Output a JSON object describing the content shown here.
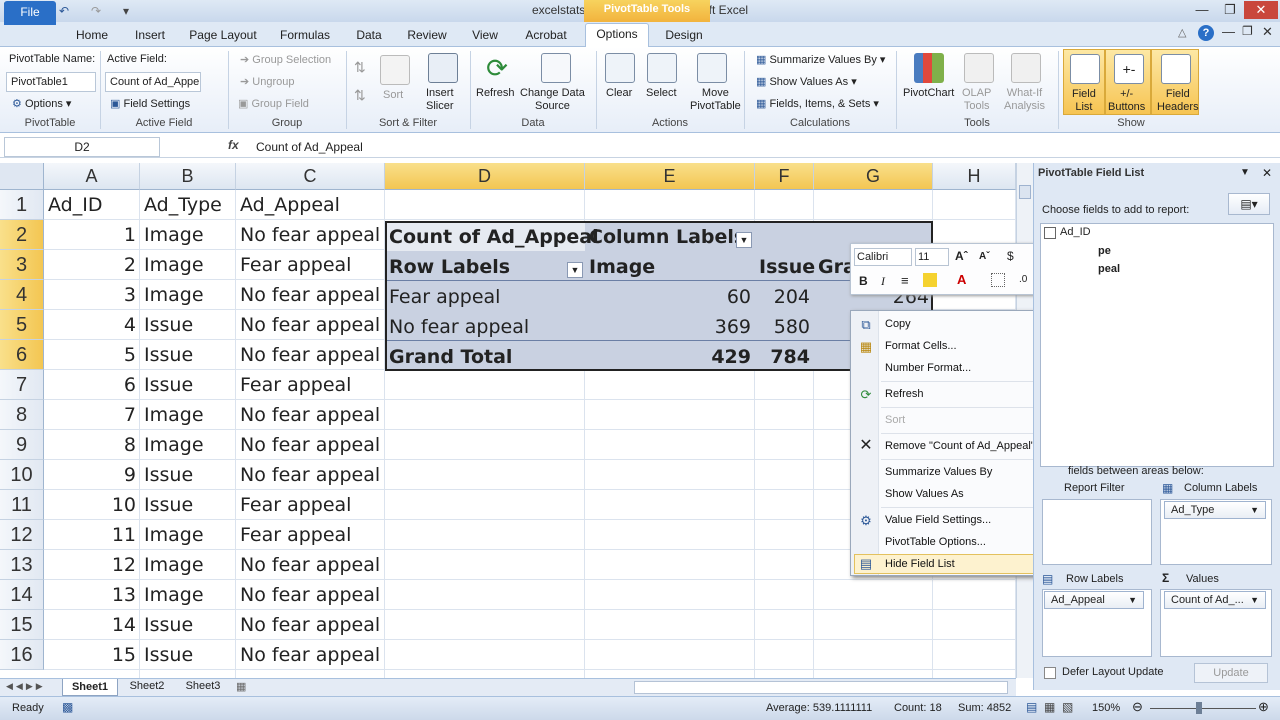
{
  "title": "excelstats_2sampchisq  -  Microsoft Excel",
  "context_tab": "PivotTable Tools",
  "tabs": [
    "File",
    "Home",
    "Insert",
    "Page Layout",
    "Formulas",
    "Data",
    "Review",
    "View",
    "Acrobat",
    "Options",
    "Design"
  ],
  "ribbon": {
    "pt_name_label": "PivotTable Name:",
    "pt_name": "PivotTable1",
    "options": "Options",
    "pivottable_group": "PivotTable",
    "active_field_label": "Active Field:",
    "active_field": "Count of Ad_Appe",
    "field_settings": "Field Settings",
    "active_field_group": "Active Field",
    "group_selection": "Group Selection",
    "ungroup": "Ungroup",
    "group_field": "Group Field",
    "group_group": "Group",
    "sort": "Sort",
    "sort_filter_group": "Sort & Filter",
    "insert_slicer": "Insert\nSlicer",
    "refresh": "Refresh",
    "change_data_source": "Change Data\nSource",
    "data_group": "Data",
    "clear": "Clear",
    "select": "Select",
    "move_pivottable": "Move\nPivotTable",
    "actions_group": "Actions",
    "summarize_values_by": "Summarize Values By",
    "show_values_as": "Show Values As",
    "fields_items_sets": "Fields, Items, & Sets",
    "calculations_group": "Calculations",
    "pivotchart": "PivotChart",
    "olap_tools": "OLAP\nTools",
    "what_if": "What-If\nAnalysis",
    "tools_group": "Tools",
    "field_list": "Field\nList",
    "plus_minus_buttons": "+/-\nButtons",
    "field_headers": "Field\nHeaders",
    "show_group": "Show"
  },
  "name_box": "D2",
  "formula": "Count of Ad_Appeal",
  "columns": [
    "A",
    "B",
    "C",
    "D",
    "E",
    "F",
    "G",
    "H"
  ],
  "rows": [
    "1",
    "2",
    "3",
    "4",
    "5",
    "6",
    "7",
    "8",
    "9",
    "10",
    "11",
    "12",
    "13",
    "14",
    "15",
    "16"
  ],
  "data": {
    "headers": [
      "Ad_ID",
      "Ad_Type",
      "Ad_Appeal"
    ],
    "id": [
      "1",
      "2",
      "3",
      "4",
      "5",
      "6",
      "7",
      "8",
      "9",
      "10",
      "11",
      "12",
      "13",
      "14",
      "15"
    ],
    "type": [
      "Image",
      "Image",
      "Image",
      "Issue",
      "Issue",
      "Issue",
      "Image",
      "Image",
      "Issue",
      "Issue",
      "Image",
      "Image",
      "Image",
      "Issue",
      "Issue"
    ],
    "appeal": [
      "No fear appeal",
      "Fear appeal",
      "No fear appeal",
      "No fear appeal",
      "No fear appeal",
      "Fear appeal",
      "No fear appeal",
      "No fear appeal",
      "No fear appeal",
      "Fear appeal",
      "Fear appeal",
      "No fear appeal",
      "No fear appeal",
      "No fear appeal",
      "No fear appeal"
    ]
  },
  "pivot": {
    "count_label": "Count of Ad_Appeal",
    "column_labels": "Column Labels",
    "row_labels": "Row Labels",
    "image": "Image",
    "issue": "Issue",
    "grand_col": "Gra",
    "r1_label": "Fear appeal",
    "r1_image": "60",
    "r1_issue": "204",
    "r1_total": "264",
    "r2_label": "No fear appeal",
    "r2_image": "369",
    "r2_issue": "580",
    "total_label": "Grand Total",
    "total_image": "429",
    "total_issue": "784"
  },
  "mini_toolbar": {
    "font": "Calibri",
    "size": "11"
  },
  "menu": {
    "copy": "Copy",
    "format_cells": "Format Cells...",
    "number_format": "Number Format...",
    "refresh": "Refresh",
    "sort": "Sort",
    "remove": "Remove \"Count of Ad_Appeal\"",
    "summarize": "Summarize Values By",
    "show_values": "Show Values As",
    "value_field_settings": "Value Field Settings...",
    "pt_options": "PivotTable Options...",
    "hide_field_list": "Hide Field List"
  },
  "field_list": {
    "title": "PivotTable Field List",
    "choose": "Choose fields to add to report:",
    "f1": "Ad_ID",
    "f2": "pe",
    "f3": "peal",
    "drag": "fields between areas below:",
    "report_filter": "Report Filter",
    "column_labels": "Column Labels",
    "row_labels": "Row Labels",
    "values": "Values",
    "col_field": "Ad_Type",
    "row_field": "Ad_Appeal",
    "val_field": "Count of Ad_...",
    "defer": "Defer Layout Update",
    "update": "Update"
  },
  "sheets": [
    "Sheet1",
    "Sheet2",
    "Sheet3"
  ],
  "status": {
    "ready": "Ready",
    "average": "Average: 539.1111111",
    "count": "Count: 18",
    "sum": "Sum: 4852",
    "zoom": "150%"
  }
}
